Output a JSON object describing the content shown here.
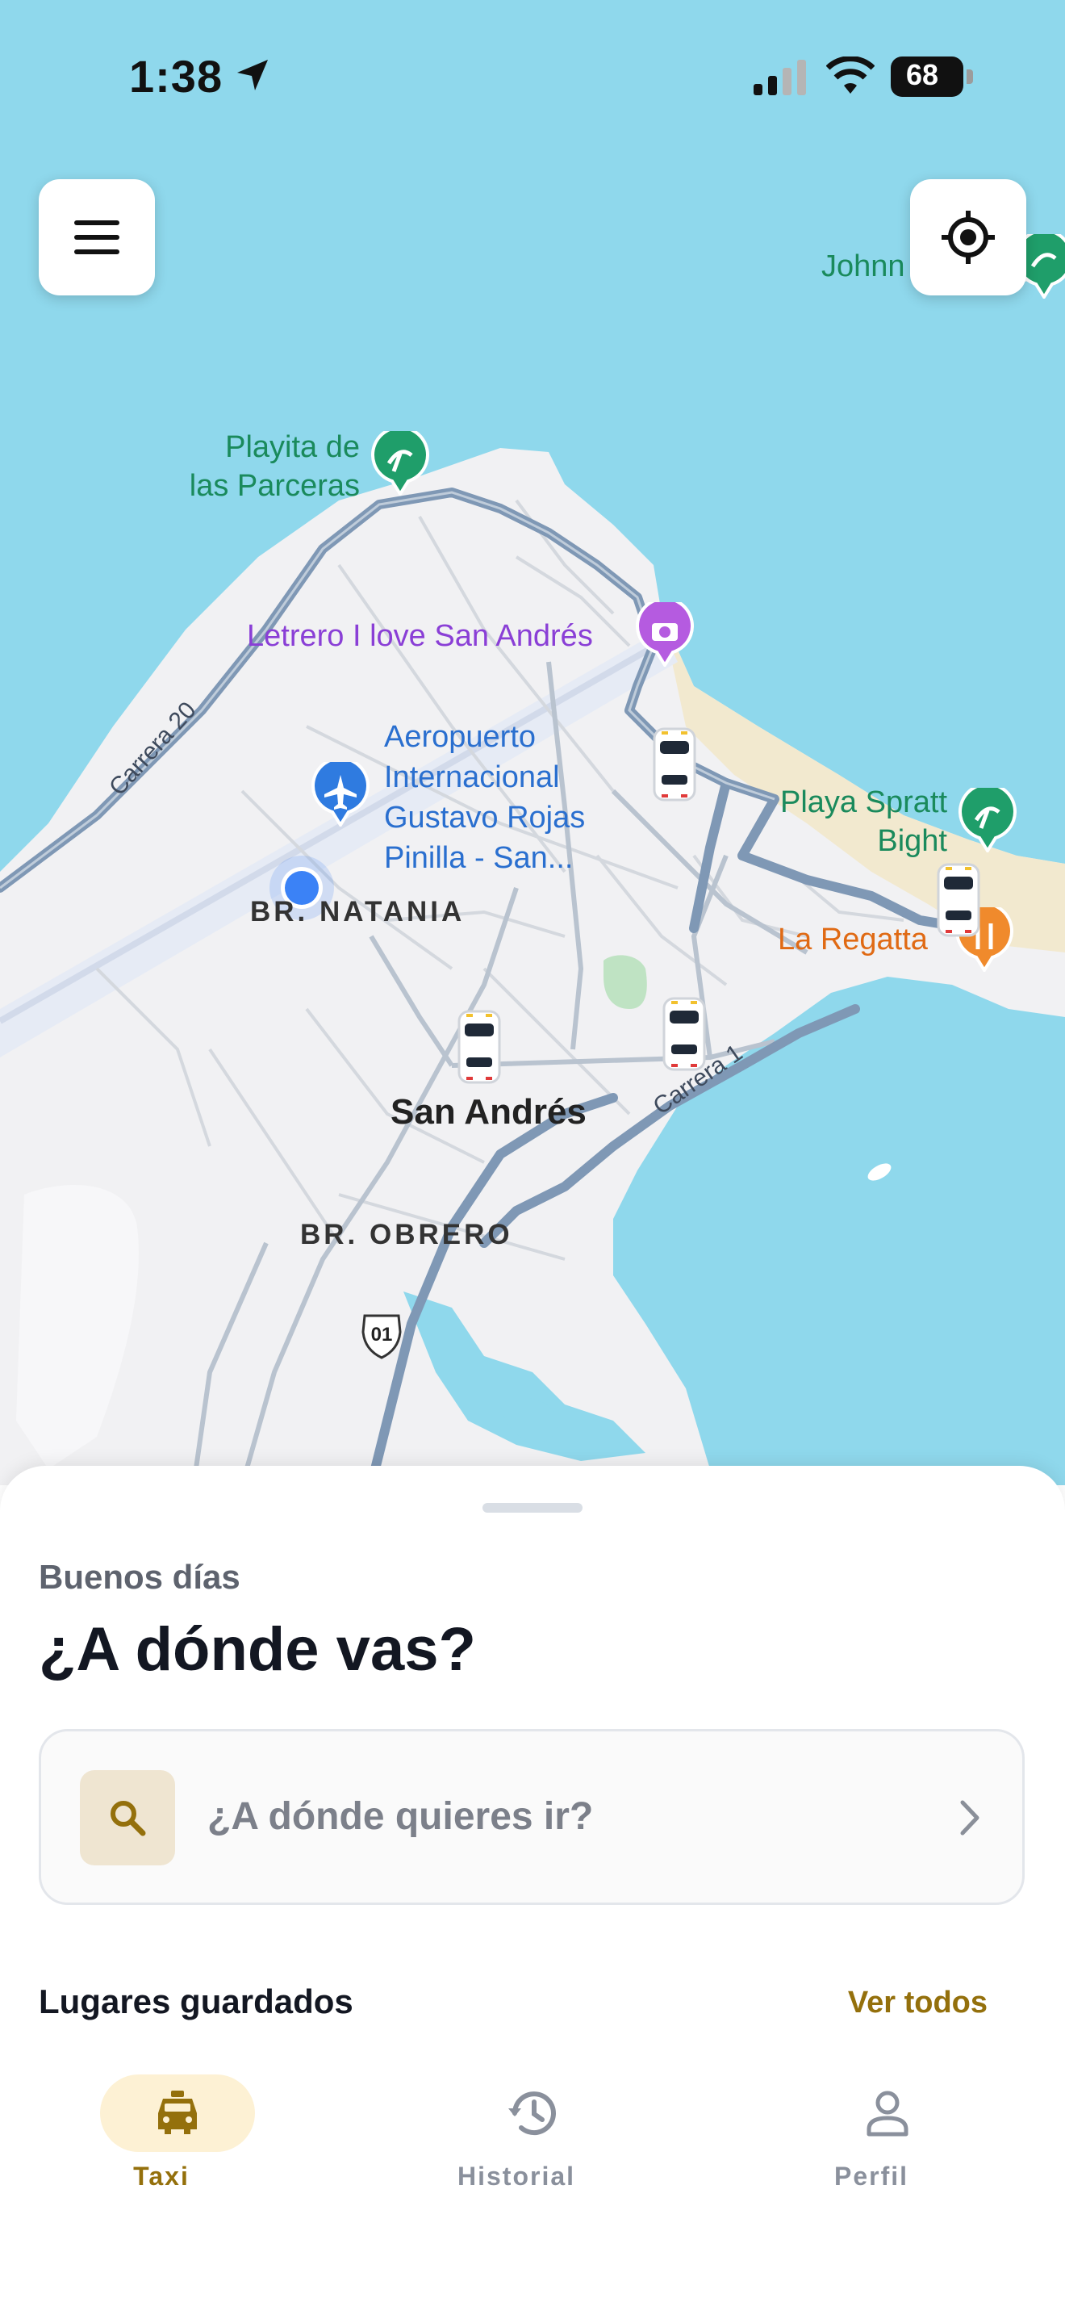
{
  "status_bar": {
    "time": "1:38",
    "battery": "68"
  },
  "map": {
    "labels": {
      "johnny": "Johnn",
      "playita_line1": "Playita de",
      "playita_line2": "las Parceras",
      "letrero": "Letrero I love San Andrés",
      "aeropuerto_line1": "Aeropuerto",
      "aeropuerto_line2": "Internacional",
      "aeropuerto_line3": "Gustavo Rojas",
      "aeropuerto_line4": "Pinilla -  San...",
      "playa_spratt_line1": "Playa Spratt",
      "playa_spratt_line2": "Bight",
      "la_regatta": "La Regatta",
      "br_natania": "BR. NATANIA",
      "san_andres": "San Andrés",
      "br_obrero": "BR. OBRERO",
      "carrera_20": "Carrera 20",
      "carrera_1": "Carrera 1",
      "route_01": "01"
    },
    "colors": {
      "water": "#8fd8ec",
      "land": "#f1f1f3",
      "beach": "#f2e9cf",
      "main_road": "#7f98b5",
      "user_dot": "#3b82f6"
    }
  },
  "sheet": {
    "greeting": "Buenos días",
    "headline": "¿A dónde vas?",
    "search_placeholder": "¿A dónde quieres ir?",
    "saved_places_title": "Lugares guardados",
    "see_all": "Ver todos"
  },
  "tabs": [
    {
      "label": "Taxi",
      "icon": "taxi-icon",
      "active": true
    },
    {
      "label": "Historial",
      "icon": "history-icon",
      "active": false
    },
    {
      "label": "Perfil",
      "icon": "profile-icon",
      "active": false
    }
  ],
  "colors": {
    "accent": "#94700c",
    "accent_bg": "#fdf1d4",
    "inactive_tab": "#8a909c",
    "headline": "#131722"
  }
}
